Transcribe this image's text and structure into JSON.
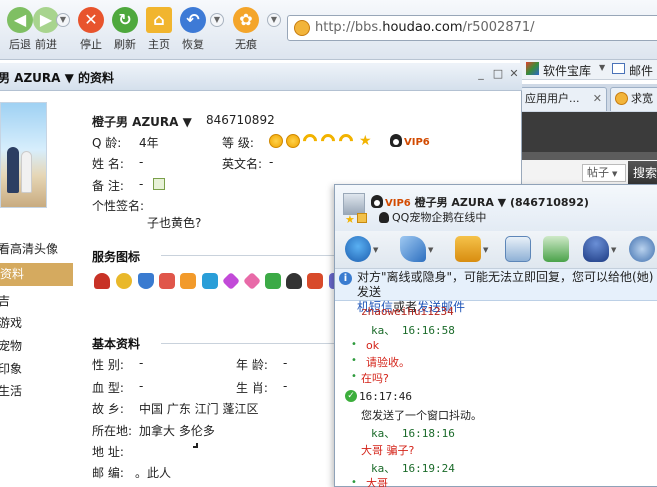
{
  "browser": {
    "nav_labels": [
      "后退",
      "前进",
      "停止",
      "刷新",
      "主页",
      "恢复",
      "无痕"
    ],
    "url_prefix": "http://bbs.",
    "url_domain": "houdao.com",
    "url_suffix": "/r5002871/",
    "bookmarks": {
      "software_store": "软件宝库",
      "mail": "邮件"
    },
    "tabs": [
      "应用用户...",
      "求宽"
    ],
    "post_select": "帖子",
    "search_button": "搜索"
  },
  "profile": {
    "window_title": "男 AZURA ▼ 的资料",
    "hd_avatar_link": "看高清头像",
    "sidebar_selected": "资料",
    "sidebar_items": [
      "吉",
      "游戏",
      "宠物",
      "印象",
      "生活"
    ],
    "nickname": "橙子男 AZURA ▼",
    "qq_number": "846710892",
    "age_label": "Q  龄:",
    "age_value": "4年",
    "level_label": "等   级:",
    "vip_label": "VIP6",
    "name_label": "姓   名:",
    "name_value": "-",
    "english_name_label": "英文名:",
    "english_name_value": "-",
    "remark_label": "备   注:",
    "remark_value": "-",
    "signature_label": "个性签名:",
    "signature_value": "子也黄色?",
    "service_header": "服务图标",
    "basic_header": "基本资料",
    "gender_label": "性   别:",
    "gender_value": "-",
    "age2_label": "年   龄:",
    "age2_value": "-",
    "blood_label": "血   型:",
    "blood_value": "-",
    "zodiac_label": "生   肖:",
    "zodiac_value": "-",
    "hometown_label": "故   乡:",
    "hometown_value": "中国 广东 江门 蓬江区",
    "location_label": "所在地:",
    "location_value": "加拿大 多伦多",
    "address_label": "地   址:",
    "postal_label": "邮   编:",
    "postal_value": "。此人"
  },
  "chat": {
    "vip_label": "VIP6",
    "contact_name": "橙子男 AZURA ▼ (846710892)",
    "status": "QQ宠物企鹅在线中",
    "notice_text": "对方\"离线或隐身\"，可能无法立即回复，您可以给他(她)发送",
    "notice_link1": "机短信",
    "notice_mid": "或者",
    "notice_link2": "发送邮件",
    "messages": [
      {
        "type": "name",
        "text": "zhaoweihui1234"
      },
      {
        "type": "time",
        "text": "ka、  16:16:58"
      },
      {
        "type": "msg",
        "text": "ok"
      },
      {
        "type": "msg",
        "text": "请验收。"
      },
      {
        "type": "msg",
        "text": "在吗?"
      },
      {
        "type": "time",
        "text": "16:17:46"
      },
      {
        "type": "sys",
        "text": "您发送了一个窗口抖动。"
      },
      {
        "type": "time",
        "text": "ka、  16:18:16"
      },
      {
        "type": "msg",
        "text": "大哥 骗子?"
      },
      {
        "type": "time",
        "text": "ka、  16:19:24"
      },
      {
        "type": "msg",
        "text": "大哥"
      }
    ]
  },
  "colors": {
    "accent": "#d5aa5f",
    "link": "#1f55b8",
    "chat_red": "#d4241a",
    "time_green": "#1b6b2a"
  }
}
